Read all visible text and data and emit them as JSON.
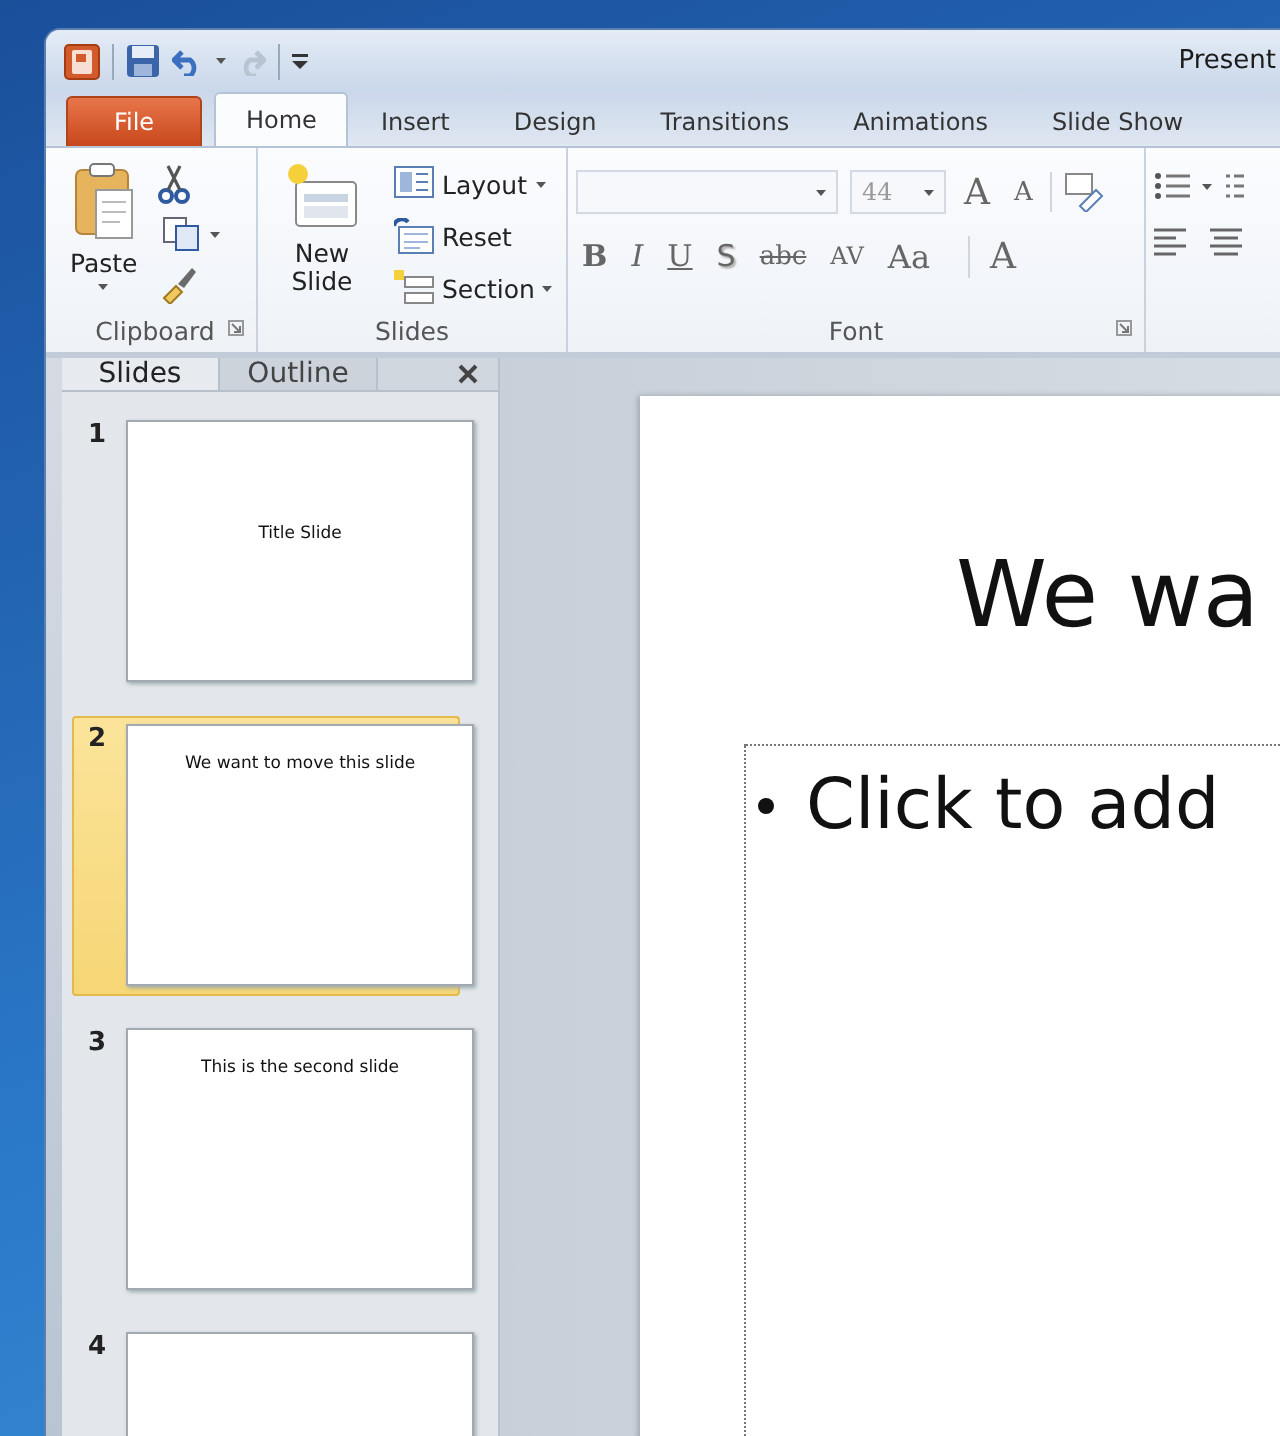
{
  "window": {
    "title": "Present"
  },
  "tabs": [
    {
      "label": "File",
      "kind": "file",
      "selected": false
    },
    {
      "label": "Home",
      "kind": "tab",
      "selected": true
    },
    {
      "label": "Insert",
      "kind": "tab",
      "selected": false
    },
    {
      "label": "Design",
      "kind": "tab",
      "selected": false
    },
    {
      "label": "Transitions",
      "kind": "tab",
      "selected": false
    },
    {
      "label": "Animations",
      "kind": "tab",
      "selected": false
    },
    {
      "label": "Slide Show",
      "kind": "tab",
      "selected": false
    }
  ],
  "ribbon": {
    "clipboard": {
      "label": "Clipboard",
      "paste": "Paste"
    },
    "slides": {
      "label": "Slides",
      "new_slide": "New Slide",
      "commands": [
        "Layout",
        "Reset",
        "Section"
      ]
    },
    "font": {
      "label": "Font",
      "font_size": "44",
      "size_buttons": [
        {
          "glyph": "A",
          "kind": "grow"
        },
        {
          "glyph": "A",
          "kind": "shrink"
        }
      ],
      "format_buttons": [
        {
          "glyph": "B",
          "kind": "bold"
        },
        {
          "glyph": "I",
          "kind": "italic"
        },
        {
          "glyph": "U",
          "kind": "underline"
        },
        {
          "glyph": "S",
          "kind": "shadow"
        },
        {
          "glyph": "abc",
          "kind": "strike"
        },
        {
          "glyph": "AV",
          "kind": "spacing"
        },
        {
          "glyph": "Aa",
          "kind": "case"
        },
        {
          "glyph": "A",
          "kind": "color"
        }
      ]
    }
  },
  "pane": {
    "tabs": [
      {
        "label": "Slides",
        "selected": true
      },
      {
        "label": "Outline",
        "selected": false
      }
    ],
    "thumbnails": [
      {
        "number": "1",
        "title": "Title Slide",
        "selected": false
      },
      {
        "number": "2",
        "title": "We want to move this slide",
        "selected": true
      },
      {
        "number": "3",
        "title": "This is the second slide",
        "selected": false
      },
      {
        "number": "4",
        "selected": false
      }
    ]
  },
  "slide": {
    "title": "We wa",
    "bullet": "Click to add"
  }
}
